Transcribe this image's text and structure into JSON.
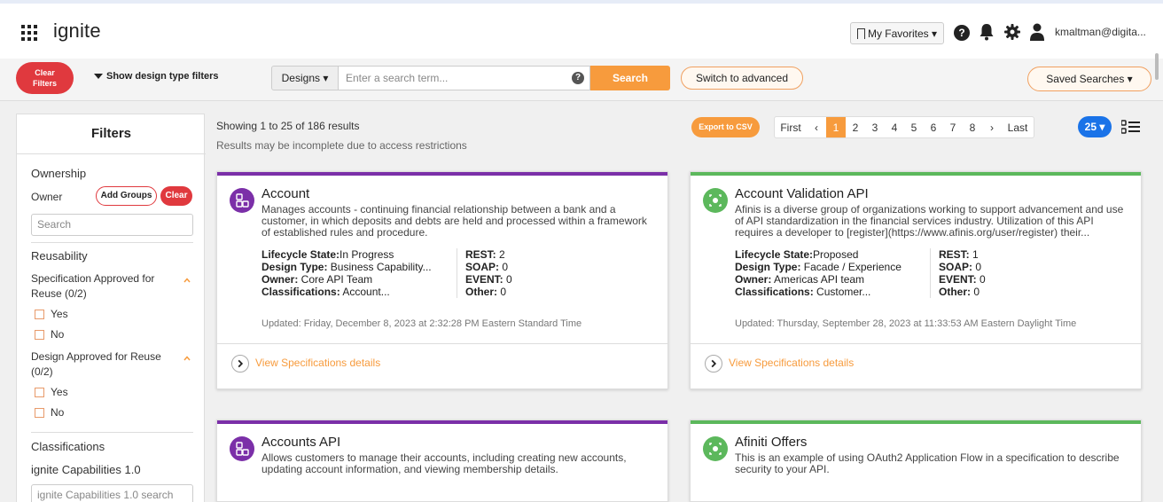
{
  "header": {
    "brand": "ignite",
    "favorites_label": "My Favorites ▾",
    "help_glyph": "?",
    "user_name": "kmaltman@digita..."
  },
  "toolbar": {
    "clear_filters_line1": "Clear",
    "clear_filters_line2": "Filters",
    "show_design_filters": "Show design type filters",
    "designs_label": "Designs ▾",
    "search_placeholder": "Enter a search term...",
    "search_button": "Search",
    "advanced_button": "Switch to advanced",
    "saved_searches": "Saved Searches ▾"
  },
  "sidebar": {
    "title": "Filters",
    "ownership": "Ownership",
    "owner_label": "Owner",
    "add_groups": "Add Groups",
    "clear": "Clear",
    "owner_search_placeholder": "Search",
    "reusability": "Reusability",
    "spec_approved": "Specification Approved for",
    "spec_approved_2": "Reuse (0/2)",
    "design_approved": "Design Approved for Reuse",
    "design_approved_2": "(0/2)",
    "yes": "Yes",
    "no": "No",
    "classifications": "Classifications",
    "capabilities": "ignite Capabilities 1.0",
    "capabilities_search": "ignite Capabilities 1.0 search"
  },
  "results": {
    "count_text": "Showing 1 to 25 of 186 results",
    "note": "Results may be incomplete due to access restrictions",
    "export_csv": "Export to CSV",
    "pager": [
      "First",
      "‹",
      "1",
      "2",
      "3",
      "4",
      "5",
      "6",
      "7",
      "8",
      "›",
      "Last"
    ],
    "active_page": "1",
    "per_page": "25 ▾"
  },
  "cards": [
    {
      "title": "Account",
      "accent_color": "#7b2fa8",
      "avatar_color": "#7b2fa8",
      "avatar_icon": "blocks-icon",
      "desc": "Manages accounts - continuing financial relationship between a bank and a customer, in which deposits and debts are held and processed within a framework of established rules and procedure.",
      "lifecycle_label": "Lifecycle State:",
      "lifecycle": "In Progress",
      "design_type_label": "Design Type:",
      "design_type": " Business Capability...",
      "owner_label": "Owner:",
      "owner": " Core API Team",
      "classifications_label": "Classifications:",
      "classifications": " Account...",
      "rest_label": "REST:",
      "rest": " 2",
      "soap_label": "SOAP:",
      "soap": " 0",
      "event_label": "EVENT:",
      "event": " 0",
      "other_label": "Other:",
      "other": " 0",
      "updated": "Updated: Friday, December 8, 2023 at 2:32:28 PM Eastern Standard Time",
      "view_link": "View Specifications details"
    },
    {
      "title": "Account Validation API",
      "accent_color": "#5cb85c",
      "avatar_color": "#5cb85c",
      "avatar_icon": "api-icon",
      "desc": "Afinis is a diverse group of organizations working to support advancement and use of API standardization in the financial services industry. Utilization of this API requires a developer to [register](https://www.afinis.org/user/register) their...",
      "lifecycle_label": "Lifecycle State:",
      "lifecycle": "Proposed",
      "design_type_label": "Design Type:",
      "design_type": " Facade / Experience",
      "owner_label": "Owner:",
      "owner": " Americas API team",
      "classifications_label": "Classifications:",
      "classifications": " Customer...",
      "rest_label": "REST:",
      "rest": " 1",
      "soap_label": "SOAP:",
      "soap": " 0",
      "event_label": "EVENT:",
      "event": " 0",
      "other_label": "Other:",
      "other": " 0",
      "updated": "Updated: Thursday, September 28, 2023 at 11:33:53 AM Eastern Daylight Time",
      "view_link": "View Specifications details"
    },
    {
      "title": "Accounts API",
      "accent_color": "#7b2fa8",
      "avatar_color": "#7b2fa8",
      "avatar_icon": "blocks-icon",
      "desc": "Allows customers to manage their accounts, including creating new accounts, updating account information, and viewing membership details."
    },
    {
      "title": "Afiniti Offers",
      "accent_color": "#5cb85c",
      "avatar_color": "#5cb85c",
      "avatar_icon": "api-icon",
      "desc": "This is an example of using OAuth2 Application Flow in a specification to describe security to your API."
    }
  ]
}
